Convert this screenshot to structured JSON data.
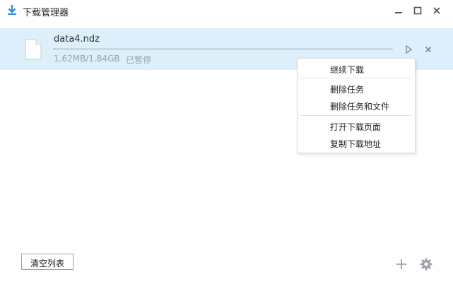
{
  "window": {
    "title": "下载管理器",
    "icons": {
      "app": "download-icon",
      "minimize": "minimize-icon",
      "maximize": "maximize-icon",
      "close": "close-icon"
    }
  },
  "download": {
    "file_name": "data4.ndz",
    "size": "1.62MB/1.84GB",
    "status": "已暂停",
    "progress_fraction": 0.00088,
    "icons": {
      "file": "file-icon",
      "resume": "play-icon",
      "remove": "close-icon"
    }
  },
  "context_menu": {
    "items": [
      {
        "label": "继续下载"
      },
      {
        "label": "删除任务"
      },
      {
        "label": "删除任务和文件"
      },
      {
        "label": "打开下载页面"
      },
      {
        "label": "复制下载地址"
      }
    ]
  },
  "footer": {
    "clear_label": "清空列表",
    "icons": {
      "add": "plus-icon",
      "settings": "gear-icon"
    }
  },
  "colors": {
    "row_highlight": "#dceffb",
    "accent": "#4aa3df",
    "muted_text": "#9aa3aa"
  }
}
